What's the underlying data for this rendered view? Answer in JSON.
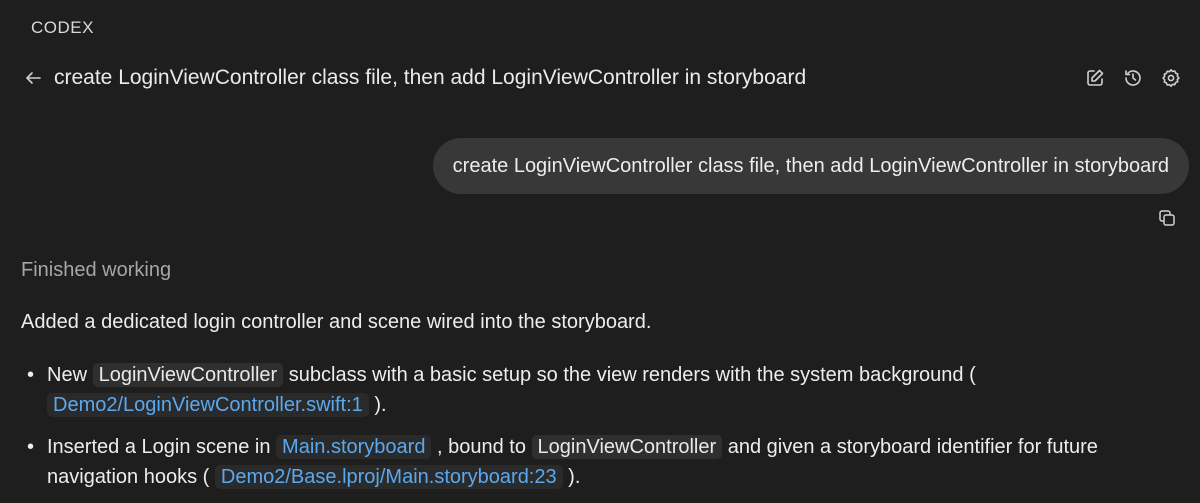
{
  "app": {
    "label": "CODEX"
  },
  "header": {
    "title": "create LoginViewController class file, then add LoginViewController in storyboard",
    "icons": {
      "back": "arrow-left-icon",
      "edit": "compose-icon",
      "history": "history-icon",
      "settings": "gear-icon"
    }
  },
  "messages": {
    "user": "create LoginViewController class file, then add LoginViewController in storyboard"
  },
  "response": {
    "status": "Finished working",
    "summary": "Added a dedicated login controller and scene wired into the storyboard.",
    "bullet1": {
      "pre": "New ",
      "code1": "LoginViewController",
      "mid": " subclass with a basic setup so the view renders with the system background ( ",
      "link": "Demo2/LoginViewController.swift:1",
      "post": " )."
    },
    "bullet2": {
      "pre": "Inserted a Login scene in ",
      "link1": "Main.storyboard",
      "mid1": " , bound to ",
      "code1": "LoginViewController",
      "mid2": " and given a storyboard identifier for future navigation hooks ( ",
      "link2": "Demo2/Base.lproj/Main.storyboard:23",
      "post": " )."
    }
  },
  "colors": {
    "background": "#1e1e1e",
    "bubble": "#383838",
    "link": "#5aa9f0",
    "muted": "#a6a6a6"
  }
}
